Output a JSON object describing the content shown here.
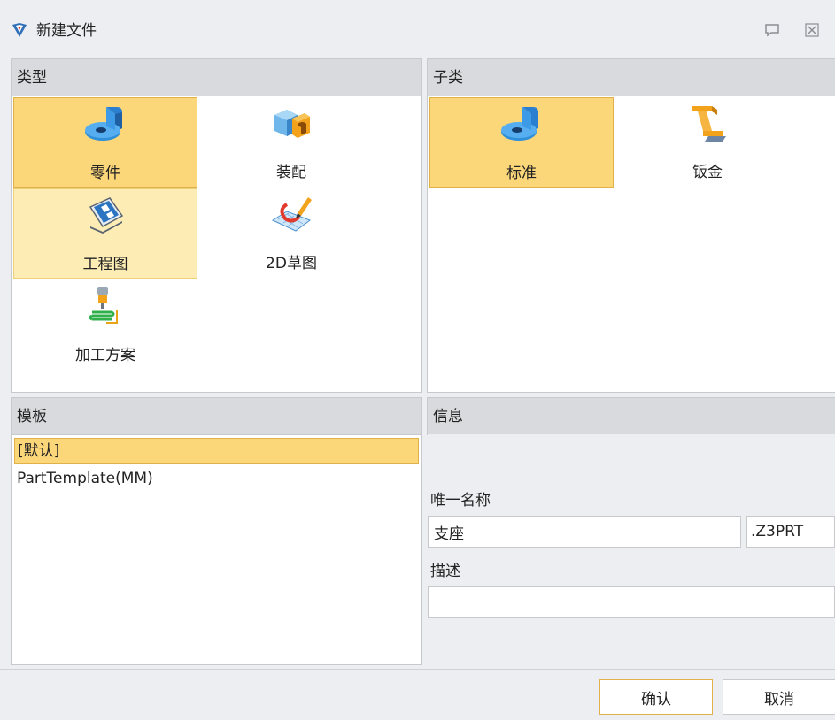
{
  "window": {
    "title": "新建文件",
    "icons": {
      "app": "zw3d-logo-icon",
      "help": "help-balloon-icon",
      "close": "close-icon"
    }
  },
  "type_panel": {
    "header": "类型",
    "items": [
      {
        "label": "零件",
        "icon": "part-icon",
        "state": "selected"
      },
      {
        "label": "装配",
        "icon": "assembly-icon",
        "state": "normal"
      },
      {
        "label": "工程图",
        "icon": "drawing-icon",
        "state": "hover"
      },
      {
        "label": "2D草图",
        "icon": "sketch-2d-icon",
        "state": "normal"
      },
      {
        "label": "加工方案",
        "icon": "machining-plan-icon",
        "state": "normal"
      }
    ]
  },
  "subtype_panel": {
    "header": "子类",
    "items": [
      {
        "label": "标准",
        "icon": "standard-part-icon",
        "state": "selected"
      },
      {
        "label": "钣金",
        "icon": "sheet-metal-icon",
        "state": "normal"
      }
    ]
  },
  "template_panel": {
    "header": "模板",
    "items": [
      {
        "label": "[默认]",
        "state": "selected"
      },
      {
        "label": "PartTemplate(MM)",
        "state": "normal"
      }
    ]
  },
  "info_panel": {
    "header": "信息",
    "name_label": "唯一名称",
    "name_value": "支座",
    "extension": ".Z3PRT",
    "description_label": "描述",
    "description_value": ""
  },
  "buttons": {
    "ok": "确认",
    "cancel": "取消"
  },
  "colors": {
    "selected_fill": "#fcd77a",
    "hover_fill": "#fdedb5",
    "header_bg": "#d8dadd",
    "dialog_bg": "#eceef2",
    "icon_blue": "#2f8fd8",
    "icon_orange": "#f3a21c"
  }
}
